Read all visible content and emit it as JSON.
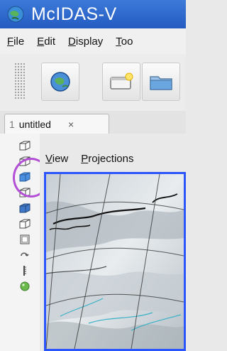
{
  "window": {
    "title": "McIDAS-V"
  },
  "menubar": {
    "items": [
      {
        "label": "File",
        "mnemonic": "F",
        "rest": "ile"
      },
      {
        "label": "Edit",
        "mnemonic": "E",
        "rest": "dit"
      },
      {
        "label": "Display",
        "mnemonic": "D",
        "rest": "isplay"
      },
      {
        "label": "Too",
        "mnemonic": "T",
        "rest": "oo"
      }
    ]
  },
  "tabs": [
    {
      "number": "1",
      "label": "untitled",
      "close": "×"
    }
  ],
  "view_menubar": {
    "items": [
      {
        "label": "View",
        "mnemonic": "V",
        "rest": "iew"
      },
      {
        "label": "Projections",
        "mnemonic": "P",
        "rest": "rojections"
      }
    ]
  },
  "icons": {
    "app": "mcidas-globe-icon",
    "toolbar": [
      "globe-icon",
      "new-window-icon",
      "open-folder-icon"
    ],
    "sidepanel": [
      "cube-view-1-icon",
      "cube-view-2-icon",
      "cube-view-3-icon",
      "cube-view-4-icon",
      "cube-view-5-icon",
      "cube-view-6-icon",
      "square-view-icon",
      "rotate-arrow-icon",
      "scale-ruler-icon",
      "green-status-icon"
    ]
  },
  "colors": {
    "title_bar": "#2f6bd0",
    "highlight_ring": "#b34fd6",
    "map_border": "#2b55ff"
  }
}
